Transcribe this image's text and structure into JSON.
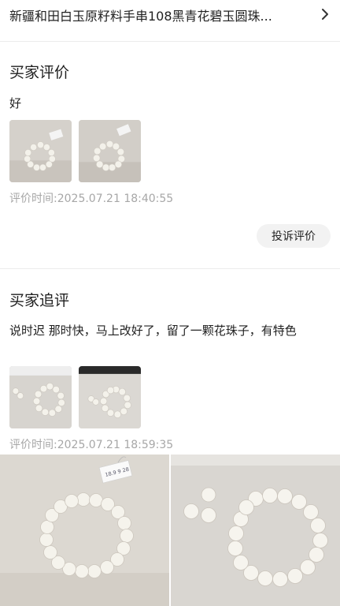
{
  "product": {
    "title": "新疆和田白玉原籽料手串108黑青花碧玉圆珠...",
    "chevron_icon": "chevron-right-icon"
  },
  "buyer_review": {
    "section_title": "买家评价",
    "text": "好",
    "time": "评价时间:2025.07.21 18:40:55",
    "photos": [
      "bracelet-photo-with-tag",
      "bracelet-photo-with-tag"
    ],
    "complaint_button": "投诉评价"
  },
  "follow_up_review": {
    "section_title": "买家追评",
    "text": "说时迟 那时快，马上改好了，留了一颗花珠子，有特色",
    "time": "评价时间:2025.07.21 18:59:35",
    "photos": [
      "bracelet-photo-with-loose-beads",
      "bracelet-photo-with-loose-beads"
    ]
  },
  "photo_viewer": {
    "photos": [
      "bracelet-photo-with-tag",
      "bracelet-photo-with-loose-beads"
    ],
    "tag_text": "18.9 9 28"
  }
}
